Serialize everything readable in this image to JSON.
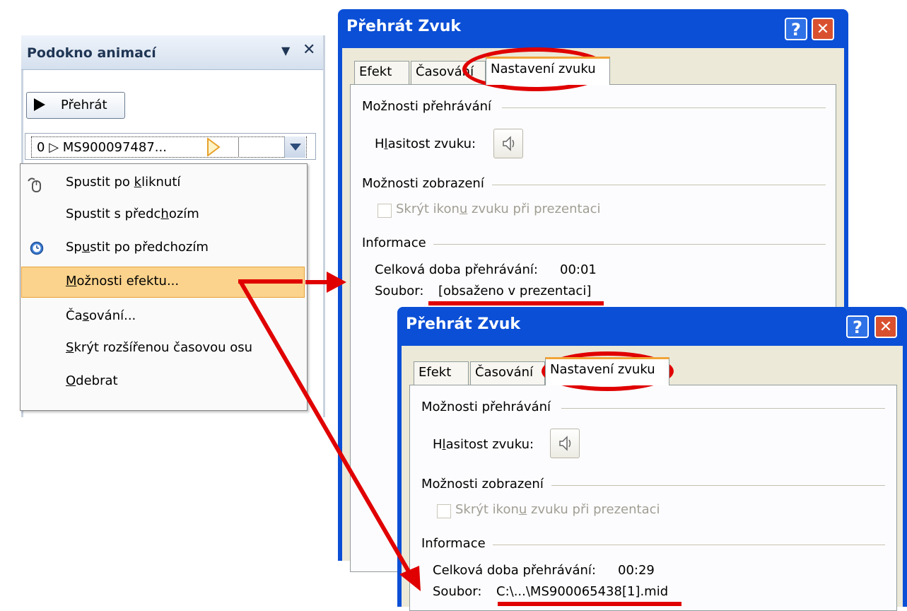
{
  "pane": {
    "title": "Podokno animací",
    "play_label": "Přehrát",
    "item": {
      "index": "0",
      "name": "MS900097487..."
    }
  },
  "menu": {
    "items": [
      {
        "label_pre": "Spustit po ",
        "label_u": "k",
        "label_post": "liknutí",
        "icon": "mouse-click-icon"
      },
      {
        "label_pre": "Spustit s předc",
        "label_u": "h",
        "label_post": "ozím",
        "icon": ""
      },
      {
        "label_pre": "Sp",
        "label_u": "u",
        "label_post": "stit po předchozím",
        "icon": "clock-icon"
      },
      {
        "label_pre": "",
        "label_u": "M",
        "label_post": "ožnosti efektu...",
        "icon": ""
      },
      {
        "label_pre": "Ča",
        "label_u": "s",
        "label_post": "ování...",
        "icon": ""
      },
      {
        "label_pre": "",
        "label_u": "S",
        "label_post": "krýt rozšířenou časovou osu",
        "icon": ""
      },
      {
        "label_pre": "",
        "label_u": "O",
        "label_post": "debrat",
        "icon": ""
      }
    ]
  },
  "dialog1": {
    "title": "Přehrát Zvuk",
    "help": "?",
    "tabs": [
      "Efekt",
      "Časování",
      "Nastavení zvuku"
    ],
    "playback_group": "Možnosti přehrávání",
    "volume_label": "Hlasitost zvuku:",
    "display_group": "Možnosti zobrazení",
    "hide_icon_label": "Skrýt ikonu zvuku při prezentaci",
    "info_group": "Informace",
    "duration_label": "Celková doba přehrávání:",
    "duration_value": "00:01",
    "file_label": "Soubor:",
    "file_value": "[obsaženo v prezentaci]"
  },
  "dialog2": {
    "title": "Přehrát Zvuk",
    "help": "?",
    "tabs": [
      "Efekt",
      "Časování",
      "Nastavení zvuku"
    ],
    "playback_group": "Možnosti přehrávání",
    "volume_label": "Hlasitost zvuku:",
    "display_group": "Možnosti zobrazení",
    "hide_icon_label": "Skrýt ikonu zvuku při prezentaci",
    "info_group": "Informace",
    "duration_label": "Celková doba přehrávání:",
    "duration_value": "00:29",
    "file_label": "Soubor:",
    "file_value": "C:\\...\\MS900065438[1].mid"
  },
  "colors": {
    "annotation": "#e00000",
    "menu_highlight": "#fbd38c",
    "title_bar": "#0b4fd6"
  }
}
